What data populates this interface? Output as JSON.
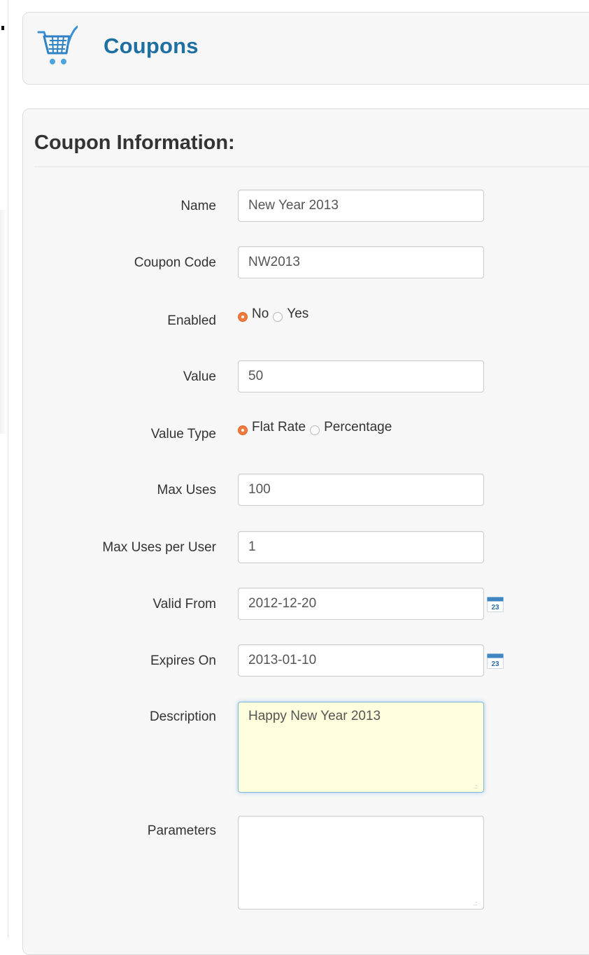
{
  "header": {
    "title": "Coupons",
    "logo_icon": "shopping-cart-icon"
  },
  "panel": {
    "title": "Coupon Information:"
  },
  "form": {
    "name": {
      "label": "Name",
      "value": "New Year 2013"
    },
    "coupon_code": {
      "label": "Coupon Code",
      "value": "NW2013"
    },
    "enabled": {
      "label": "Enabled",
      "options": [
        "No",
        "Yes"
      ],
      "selected": "No"
    },
    "value": {
      "label": "Value",
      "value": "50"
    },
    "value_type": {
      "label": "Value Type",
      "options": [
        "Flat Rate",
        "Percentage"
      ],
      "selected": "Flat Rate"
    },
    "max_uses": {
      "label": "Max Uses",
      "value": "100"
    },
    "max_uses_per_user": {
      "label": "Max Uses per User",
      "value": "1"
    },
    "valid_from": {
      "label": "Valid From",
      "value": "2012-12-20",
      "calendar_day": "23"
    },
    "expires_on": {
      "label": "Expires On",
      "value": "2013-01-10",
      "calendar_day": "23"
    },
    "description": {
      "label": "Description",
      "value": "Happy New Year 2013"
    },
    "parameters": {
      "label": "Parameters",
      "value": ""
    }
  },
  "colors": {
    "title_blue": "#1e6fa2",
    "radio_checked": "#f07a3c",
    "focused_bg": "#ffffdd"
  }
}
